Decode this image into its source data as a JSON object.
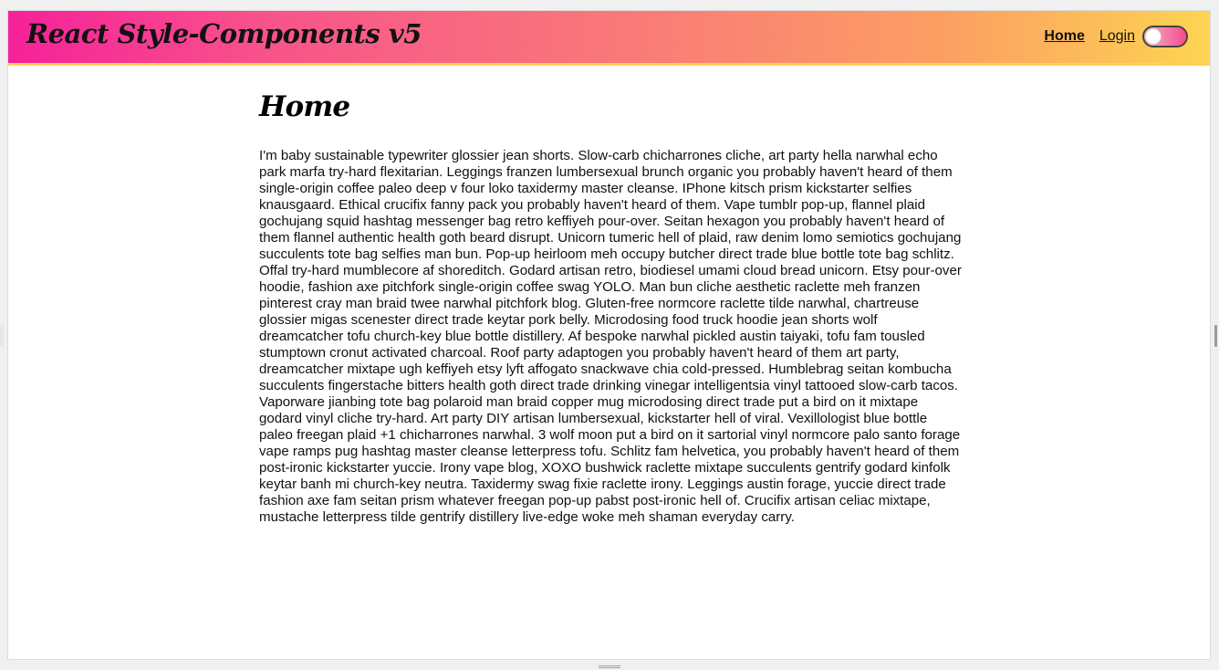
{
  "header": {
    "brand": "React Style-Components v5",
    "nav": {
      "home_label": "Home",
      "login_label": "Login"
    },
    "theme_toggle": {
      "state": "off"
    }
  },
  "main": {
    "title": "Home",
    "paragraph": "I'm baby sustainable typewriter glossier jean shorts. Slow-carb chicharrones cliche, art party hella narwhal echo park marfa try-hard flexitarian. Leggings franzen lumbersexual brunch organic you probably haven't heard of them single-origin coffee paleo deep v four loko taxidermy master cleanse. IPhone kitsch prism kickstarter selfies knausgaard. Ethical crucifix fanny pack you probably haven't heard of them. Vape tumblr pop-up, flannel plaid gochujang squid hashtag messenger bag retro keffiyeh pour-over. Seitan hexagon you probably haven't heard of them flannel authentic health goth beard disrupt. Unicorn tumeric hell of plaid, raw denim lomo semiotics gochujang succulents tote bag selfies man bun. Pop-up heirloom meh occupy butcher direct trade blue bottle tote bag schlitz. Offal try-hard mumblecore af shoreditch. Godard artisan retro, biodiesel umami cloud bread unicorn. Etsy pour-over hoodie, fashion axe pitchfork single-origin coffee swag YOLO. Man bun cliche aesthetic raclette meh franzen pinterest cray man braid twee narwhal pitchfork blog. Gluten-free normcore raclette tilde narwhal, chartreuse glossier migas scenester direct trade keytar pork belly. Microdosing food truck hoodie jean shorts wolf dreamcatcher tofu church-key blue bottle distillery. Af bespoke narwhal pickled austin taiyaki, tofu fam tousled stumptown cronut activated charcoal. Roof party adaptogen you probably haven't heard of them art party, dreamcatcher mixtape ugh keffiyeh etsy lyft affogato snackwave chia cold-pressed. Humblebrag seitan kombucha succulents fingerstache bitters health goth direct trade drinking vinegar intelligentsia vinyl tattooed slow-carb tacos. Vaporware jianbing tote bag polaroid man braid copper mug microdosing direct trade put a bird on it mixtape godard vinyl cliche try-hard. Art party DIY artisan lumbersexual, kickstarter hell of viral. Vexillologist blue bottle paleo freegan plaid +1 chicharrones narwhal. 3 wolf moon put a bird on it sartorial vinyl normcore palo santo forage vape ramps pug hashtag master cleanse letterpress tofu. Schlitz fam helvetica, you probably haven't heard of them post-ironic kickstarter yuccie. Irony vape blog, XOXO bushwick raclette mixtape succulents gentrify godard kinfolk keytar banh mi church-key neutra. Taxidermy swag fixie raclette irony. Leggings austin forage, yuccie direct trade fashion axe fam seitan prism whatever freegan pop-up pabst post-ironic hell of. Crucifix artisan celiac mixtape, mustache letterpress tilde gentrify distillery live-edge woke meh shaman everyday carry."
  },
  "colors": {
    "header_gradient_start": "#f6219a",
    "header_gradient_end": "#fdd451",
    "header_border": "#fbd25a",
    "text": "#111111",
    "background": "#ffffff"
  }
}
